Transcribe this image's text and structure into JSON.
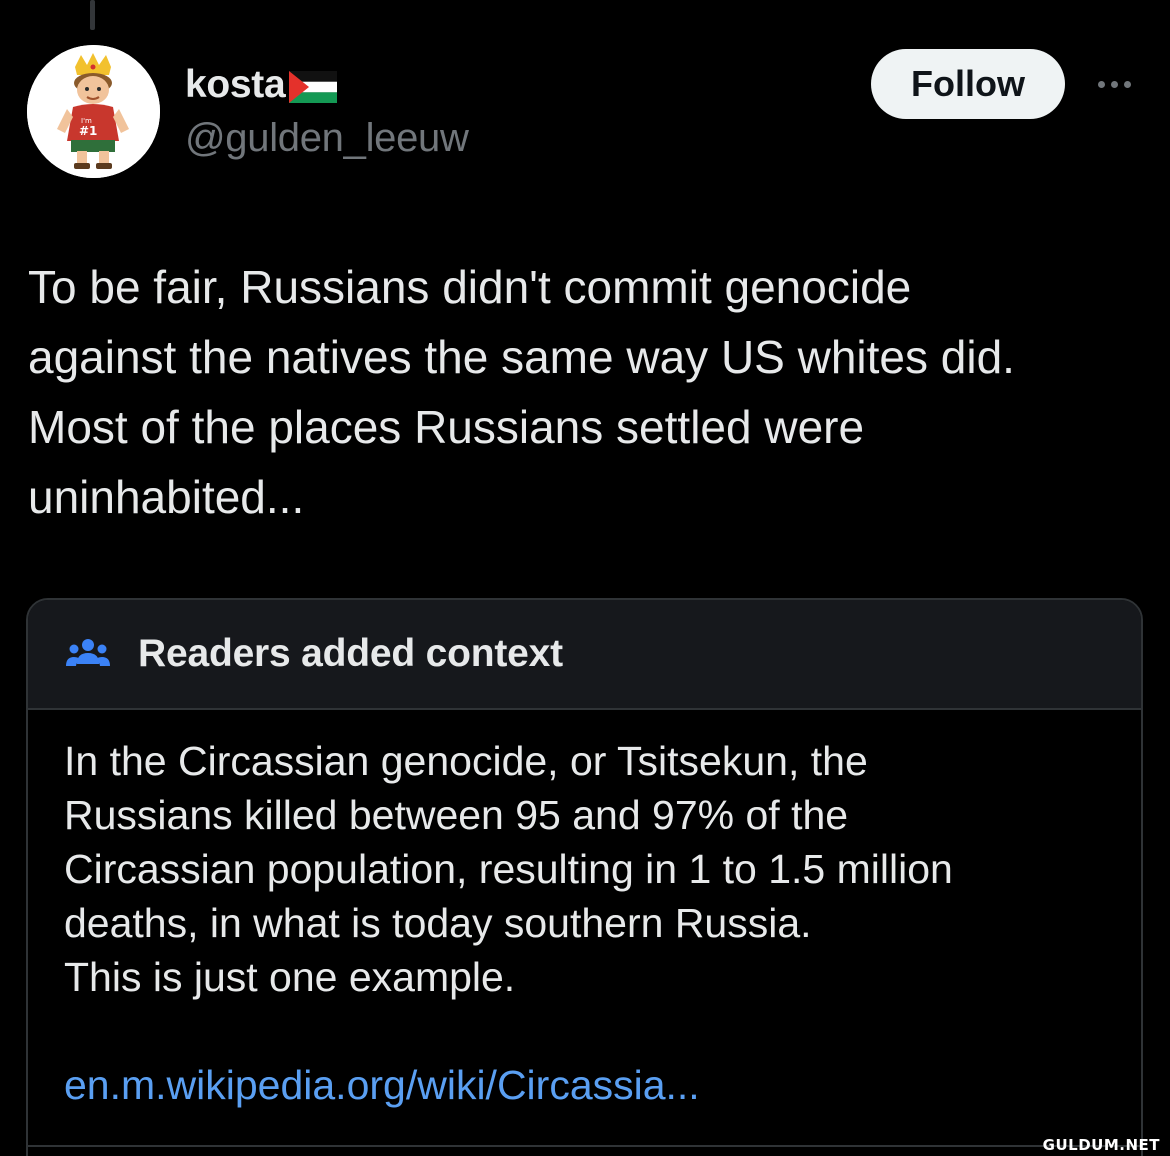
{
  "author": {
    "display_name": "kosta",
    "handle": "@gulden_leeuw",
    "flag_icon": "palestine-flag-icon",
    "avatar_jersey_text": "I'm #1"
  },
  "actions": {
    "follow_label": "Follow",
    "more_icon": "ellipsis-icon"
  },
  "tweet": {
    "text": "To be fair, Russians didn't commit genocide\nagainst the natives the same way US whites did.\nMost of the places Russians settled were\nuninhabited..."
  },
  "community_note": {
    "icon": "people-icon",
    "title": "Readers added context",
    "body": "In the Circassian genocide, or Tsitsekun, the\nRussians killed between 95 and 97% of the\nCircassian population, resulting in 1 to 1.5 million\ndeaths, in what is today southern Russia.\nThis is just one example.",
    "link_text": "en.m.wikipedia.org/wiki/Circassia..."
  },
  "watermark": "GULDUM.NET",
  "colors": {
    "background": "#000000",
    "text_primary": "#e7e9ea",
    "text_secondary": "#71767b",
    "link": "#5a9ff2",
    "note_accent": "#3b82f6",
    "follow_button_bg": "#eff3f4"
  }
}
